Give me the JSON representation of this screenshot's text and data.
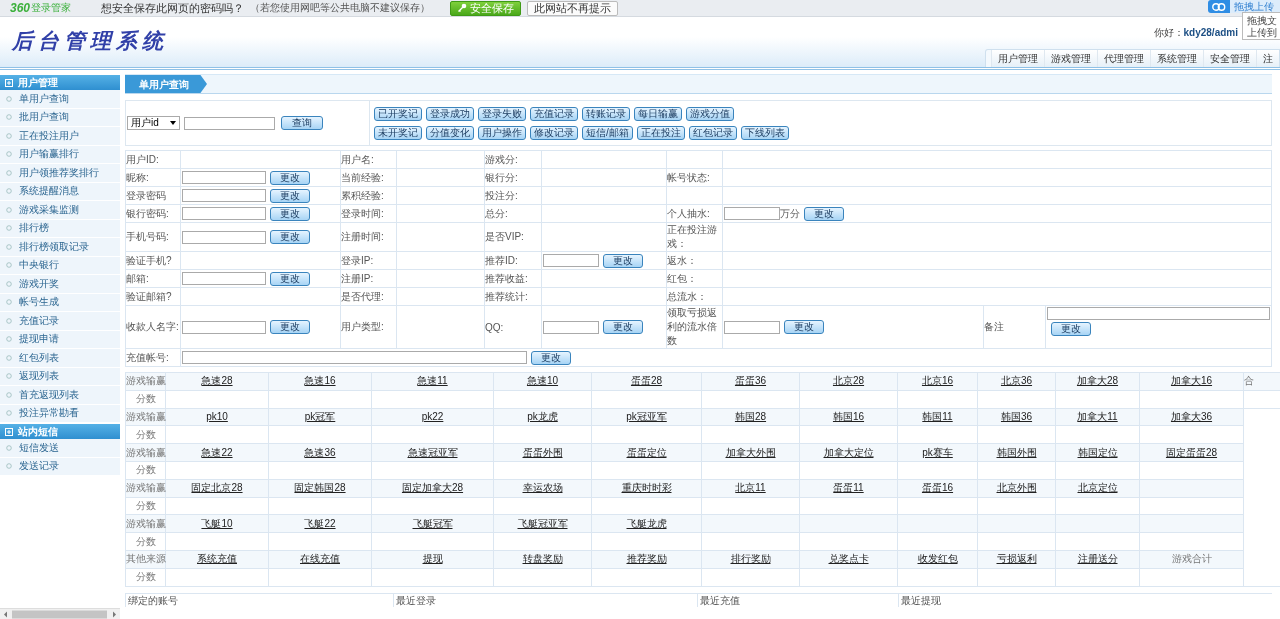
{
  "browser_bar": {
    "logo_number": "360",
    "logo_text": "登录管家",
    "prompt": "想安全保存此网页的密码吗？",
    "note": "（若您使用网吧等公共电脑不建议保存）",
    "buttons": [
      {
        "label": "安全保存",
        "kind": "primary"
      },
      {
        "label": "此网站不再提示",
        "kind": "plain"
      }
    ],
    "upload": "拖拽上传",
    "tooltip": [
      "拖拽文",
      "上传到"
    ]
  },
  "header": {
    "title": "后台管理系统",
    "greeting": "你好：",
    "user": "kdy28/admi",
    "nav": [
      "用户管理",
      "游戏管理",
      "代理管理",
      "系统管理",
      "安全管理",
      "注"
    ]
  },
  "sidebar": [
    {
      "title": "用户管理",
      "items": [
        "单用户查询",
        "批用户查询",
        "正在投注用户",
        "用户输赢排行",
        "用户领推荐奖排行",
        "系统提醒消息",
        "游戏采集监测",
        "排行榜",
        "排行榜领取记录",
        "中央银行",
        "游戏开奖",
        "帐号生成",
        "充值记录",
        "提现申请",
        "红包列表",
        "返现列表",
        "首充返现列表",
        "投注异常勘看"
      ]
    },
    {
      "title": "站内短信",
      "items": [
        "短信发送",
        "发送记录"
      ]
    }
  ],
  "page_tab": "单用户查询",
  "query": {
    "select": "用户id",
    "button": "查询",
    "record_buttons": [
      [
        "已开奖记",
        "登录成功",
        "登录失败",
        "充值记录",
        "转账记录",
        "每日输赢",
        "游戏分值"
      ],
      [
        "未开奖记",
        "分值变化",
        "用户操作",
        "修改记录",
        "短信/邮箱",
        "正在投注",
        "红包记录",
        "下线列表"
      ]
    ]
  },
  "info_rows": [
    [
      {
        "kind": "label",
        "text": "用户ID:"
      },
      {
        "kind": "value"
      },
      {
        "kind": "label",
        "text": "用户名:"
      },
      {
        "kind": "value"
      },
      {
        "kind": "label",
        "text": "游戏分:"
      },
      {
        "kind": "value"
      },
      {
        "kind": "value"
      },
      {
        "kind": "value"
      }
    ],
    [
      {
        "kind": "label",
        "text": "昵称:"
      },
      {
        "kind": "field",
        "button": "更改"
      },
      {
        "kind": "label",
        "text": "当前经验:"
      },
      {
        "kind": "value"
      },
      {
        "kind": "label",
        "text": "银行分:"
      },
      {
        "kind": "value"
      },
      {
        "kind": "label",
        "text": "帐号状态:"
      },
      {
        "kind": "value"
      }
    ],
    [
      {
        "kind": "label",
        "text": "登录密码"
      },
      {
        "kind": "field",
        "button": "更改"
      },
      {
        "kind": "label",
        "text": "累积经验:"
      },
      {
        "kind": "value"
      },
      {
        "kind": "label",
        "text": "投注分:"
      },
      {
        "kind": "value"
      },
      {
        "kind": "value"
      },
      {
        "kind": "value"
      }
    ],
    [
      {
        "kind": "label",
        "text": "银行密码:"
      },
      {
        "kind": "field",
        "button": "更改"
      },
      {
        "kind": "label",
        "text": "登录时间:"
      },
      {
        "kind": "value"
      },
      {
        "kind": "label",
        "text": "总分:"
      },
      {
        "kind": "value"
      },
      {
        "kind": "label",
        "text": "个人抽水:"
      },
      {
        "kind": "field",
        "unit": "万分",
        "button": "更改"
      }
    ],
    [
      {
        "kind": "label",
        "text": "手机号码:"
      },
      {
        "kind": "field",
        "button": "更改"
      },
      {
        "kind": "label",
        "text": "注册时间:"
      },
      {
        "kind": "value"
      },
      {
        "kind": "label",
        "text": "是否VIP:"
      },
      {
        "kind": "value"
      },
      {
        "kind": "label",
        "text": "正在投注游戏："
      },
      {
        "kind": "value"
      }
    ],
    [
      {
        "kind": "label",
        "text": "验证手机?"
      },
      {
        "kind": "value"
      },
      {
        "kind": "label",
        "text": "登录IP:"
      },
      {
        "kind": "value"
      },
      {
        "kind": "label",
        "text": "推荐ID:"
      },
      {
        "kind": "field",
        "button": "更改"
      },
      {
        "kind": "label",
        "text": "返水："
      },
      {
        "kind": "value"
      }
    ],
    [
      {
        "kind": "label",
        "text": "邮箱:"
      },
      {
        "kind": "field",
        "button": "更改"
      },
      {
        "kind": "label",
        "text": "注册IP:"
      },
      {
        "kind": "value"
      },
      {
        "kind": "label",
        "text": "推荐收益:"
      },
      {
        "kind": "value"
      },
      {
        "kind": "label",
        "text": "红包："
      },
      {
        "kind": "value"
      }
    ],
    [
      {
        "kind": "label",
        "text": "验证邮箱?"
      },
      {
        "kind": "value"
      },
      {
        "kind": "label",
        "text": "是否代理:"
      },
      {
        "kind": "value"
      },
      {
        "kind": "label",
        "text": "推荐统计:"
      },
      {
        "kind": "value"
      },
      {
        "kind": "label",
        "text": "总流水："
      },
      {
        "kind": "value"
      }
    ],
    [
      {
        "kind": "label",
        "text": "收款人名字:"
      },
      {
        "kind": "field",
        "button": "更改"
      },
      {
        "kind": "label",
        "text": "用户类型:"
      },
      {
        "kind": "value"
      },
      {
        "kind": "label",
        "text": "QQ:"
      },
      {
        "kind": "field",
        "button": "更改"
      },
      {
        "kind": "label",
        "text": "领取亏损返利的流水倍数"
      },
      {
        "kind": "field",
        "button": "更改"
      },
      {
        "kind": "label",
        "text": "备注"
      },
      {
        "kind": "stacked_field",
        "button": "更改"
      }
    ],
    [
      {
        "kind": "label",
        "text": "充值帐号:"
      },
      {
        "kind": "wide_field",
        "button": "更改"
      }
    ]
  ],
  "games": [
    {
      "label": "游戏输赢",
      "score_label": "分数",
      "total": "合",
      "items": [
        {
          "kind": "link",
          "text": "急速28"
        },
        {
          "kind": "link",
          "text": "急速16"
        },
        {
          "kind": "link",
          "text": "急速11"
        },
        {
          "kind": "link",
          "text": "急速10"
        },
        {
          "kind": "link",
          "text": "蛋蛋28"
        },
        {
          "kind": "link",
          "text": "蛋蛋36"
        },
        {
          "kind": "link",
          "text": "北京28"
        },
        {
          "kind": "link",
          "text": "北京16"
        },
        {
          "kind": "link",
          "text": "北京36"
        },
        {
          "kind": "link",
          "text": "加拿大28"
        },
        {
          "kind": "link",
          "text": "加拿大16"
        }
      ]
    },
    {
      "label": "游戏输赢",
      "score_label": "分数",
      "items": [
        {
          "kind": "link",
          "text": "pk10"
        },
        {
          "kind": "link",
          "text": "pk冠军"
        },
        {
          "kind": "link",
          "text": "pk22"
        },
        {
          "kind": "link",
          "text": "pk龙虎"
        },
        {
          "kind": "link",
          "text": "pk冠亚军"
        },
        {
          "kind": "link",
          "text": "韩国28"
        },
        {
          "kind": "link",
          "text": "韩国16"
        },
        {
          "kind": "link",
          "text": "韩国11"
        },
        {
          "kind": "link",
          "text": "韩国36"
        },
        {
          "kind": "link",
          "text": "加拿大11"
        },
        {
          "kind": "link",
          "text": "加拿大36"
        }
      ]
    },
    {
      "label": "游戏输赢",
      "score_label": "分数",
      "items": [
        {
          "kind": "link",
          "text": "急速22"
        },
        {
          "kind": "link",
          "text": "急速36"
        },
        {
          "kind": "link",
          "text": "急速冠亚军"
        },
        {
          "kind": "link",
          "text": "蛋蛋外围"
        },
        {
          "kind": "link",
          "text": "蛋蛋定位"
        },
        {
          "kind": "link",
          "text": "加拿大外围"
        },
        {
          "kind": "link",
          "text": "加拿大定位"
        },
        {
          "kind": "link",
          "text": "pk赛车"
        },
        {
          "kind": "link",
          "text": "韩国外围"
        },
        {
          "kind": "link",
          "text": "韩国定位"
        },
        {
          "kind": "link",
          "text": "固定蛋蛋28"
        }
      ]
    },
    {
      "label": "游戏输赢",
      "score_label": "分数",
      "items": [
        {
          "kind": "link",
          "text": "固定北京28"
        },
        {
          "kind": "link",
          "text": "固定韩国28"
        },
        {
          "kind": "link",
          "text": "固定加拿大28"
        },
        {
          "kind": "link",
          "text": "幸运农场"
        },
        {
          "kind": "link",
          "text": "重庆时时彩"
        },
        {
          "kind": "link",
          "text": "北京11"
        },
        {
          "kind": "link",
          "text": "蛋蛋11"
        },
        {
          "kind": "link",
          "text": "蛋蛋16"
        },
        {
          "kind": "link",
          "text": "北京外围"
        },
        {
          "kind": "link",
          "text": "北京定位"
        },
        {
          "kind": "blank"
        }
      ]
    },
    {
      "label": "游戏输赢",
      "score_label": "分数",
      "items": [
        {
          "kind": "link",
          "text": "飞艇10"
        },
        {
          "kind": "link",
          "text": "飞艇22"
        },
        {
          "kind": "link",
          "text": "飞艇冠军"
        },
        {
          "kind": "link",
          "text": "飞艇冠亚军"
        },
        {
          "kind": "link",
          "text": "飞艇龙虎"
        },
        {
          "kind": "blank"
        },
        {
          "kind": "blank"
        },
        {
          "kind": "blank"
        },
        {
          "kind": "blank"
        },
        {
          "kind": "blank"
        },
        {
          "kind": "blank"
        }
      ]
    },
    {
      "label": "其他来源",
      "score_label": "分数",
      "items": [
        {
          "kind": "link",
          "text": "系统充值"
        },
        {
          "kind": "link",
          "text": "在线充值"
        },
        {
          "kind": "link",
          "text": "提现"
        },
        {
          "kind": "link",
          "text": "转盘奖励"
        },
        {
          "kind": "link",
          "text": "推荐奖励"
        },
        {
          "kind": "link",
          "text": "排行奖励"
        },
        {
          "kind": "link",
          "text": "兑奖点卡"
        },
        {
          "kind": "link",
          "text": "收发红包"
        },
        {
          "kind": "link",
          "text": "亏损返利"
        },
        {
          "kind": "link",
          "text": "注册送分"
        },
        {
          "kind": "plain",
          "text": "游戏合计"
        }
      ]
    }
  ],
  "bottom": [
    "绑定的账号",
    "最近登录",
    "最近充值",
    "最近提现"
  ]
}
